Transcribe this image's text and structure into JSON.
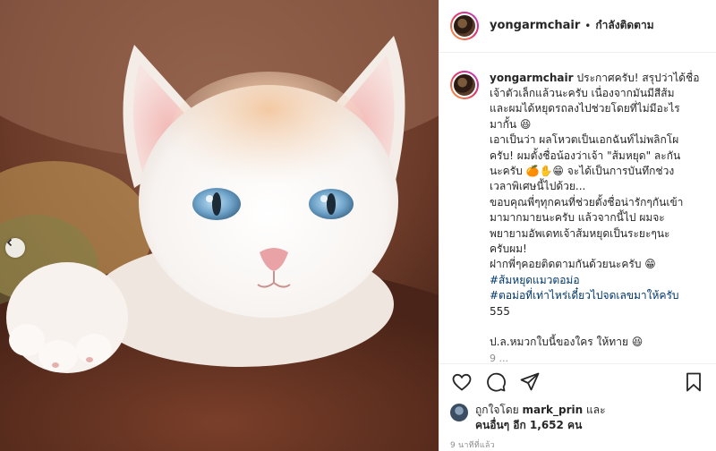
{
  "post": {
    "username": "yongarmchair",
    "follow_status": "กำลังติดตาม",
    "caption_lines": [
      "ประกาศครับ! สรุปว่าได้ชื่อ",
      "เจ้าตัวเล็กแล้วนะครับ เนื่องจากมันมีสีส้ม",
      "และผมได้หยุดรถลงไปช่วยโดยที่ไม่มีอะไร",
      "มากั้น 😆",
      "เอาเป็นว่า ผลโหวตเป็นเอกฉันท์ไม่พลิกโผ",
      "ครับ! ผมตั้งชื่อน้องว่าเจ้า \"ส้มหยุด\" ละกัน",
      "นะครับ 🍊✋😁 จะได้เป็นการบันทึกช่วง",
      "เวลาพิเศษนี้ไปด้วย...",
      "ขอบคุณพี่ๆทุกคนที่ช่วยตั้งชื่อน่ารักๆกันเข้า",
      "มามากมายนะครับ แล้วจากนี้ไป ผมจะ",
      "พยายามอัพเดทเจ้าส้มหยุดเป็นระยะๆนะ",
      "ครับผม!",
      "ฝากพี่ๆคอยติดตามกันด้วยนะครับ 😁"
    ],
    "hashtags": [
      "#ส้มหยุดแมวตอม่อ",
      "#ตอม่อที่เท่าไหร่เดี๋ยวไปจดเลขมาให้ครับ"
    ],
    "extra_lines": [
      "555",
      "",
      "ป.ล.หมวกใบนี้ของใคร ให้ทาย 😆"
    ],
    "faded_line": "9 ...",
    "likes_prefix": "ถูกใจโดย",
    "likes_user": "mark_prin",
    "likes_and": "และ",
    "likes_others": "คนอื่นๆ อีก 1,652 คน",
    "timestamp": "9 นาทีที่แล้ว"
  },
  "icons": {
    "like": "heart-icon",
    "comment": "comment-bubble-icon",
    "share": "paper-plane-icon",
    "save": "bookmark-icon",
    "carousel_prev": "chevron-left-icon"
  },
  "colors": {
    "text": "#262626",
    "muted": "#8e8e8e",
    "link": "#00376b",
    "border": "#efefef"
  }
}
